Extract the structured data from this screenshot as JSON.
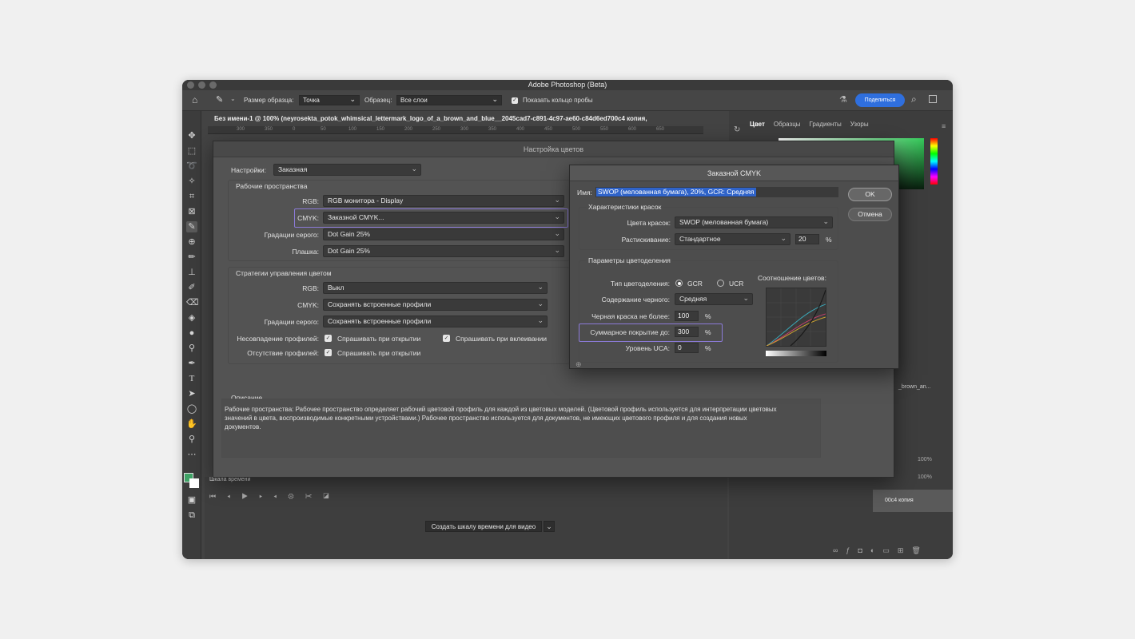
{
  "app": {
    "title": "Adobe Photoshop (Beta)",
    "share_label": "Поделиться"
  },
  "options_bar": {
    "sample_size_label": "Размер образца:",
    "sample_size_value": "Точка",
    "sample_label": "Образец:",
    "sample_value": "Все слои",
    "show_ring_label": "Показать кольцо пробы"
  },
  "document": {
    "tab_title": "Без имени-1 @ 100% (neyrosekta_potok_whimsical_lettermark_logo_of_a_brown_and_blue__2045cad7-c891-4c97-ae60-c84d6ed700c4 копия,",
    "ruler_ticks": [
      "300",
      "350",
      "0",
      "50",
      "100",
      "150",
      "200",
      "250",
      "300",
      "350",
      "400",
      "450",
      "500",
      "550",
      "600",
      "650"
    ]
  },
  "right_panel": {
    "tabs": [
      "Цвет",
      "Образцы",
      "Градиенты",
      "Узоры"
    ],
    "layer_name_fragment": "_brown_an...",
    "layer_copy_fragment": "00c4 копия",
    "opacity_value": "100%",
    "fill_value": "100%"
  },
  "timeline": {
    "label": "Шкала времени",
    "create_button": "Создать шкалу времени для видео"
  },
  "color_settings": {
    "title": "Настройка цветов",
    "settings_label": "Настройки:",
    "settings_value": "Заказная",
    "working_spaces": {
      "heading": "Рабочие пространства",
      "rgb_label": "RGB:",
      "rgb_value": "RGB монитора - Display",
      "cmyk_label": "CMYK:",
      "cmyk_value": "Заказной CMYK...",
      "gray_label": "Градации серого:",
      "gray_value": "Dot Gain 25%",
      "spot_label": "Плашка:",
      "spot_value": "Dot Gain 25%"
    },
    "policies": {
      "heading": "Стратегии управления цветом",
      "rgb_label": "RGB:",
      "rgb_value": "Выкл",
      "cmyk_label": "CMYK:",
      "cmyk_value": "Сохранять встроенные профили",
      "gray_label": "Градации серого:",
      "gray_value": "Сохранять встроенные профили",
      "mismatch_label": "Несовпадение профилей:",
      "ask_open": "Спрашивать при открытии",
      "ask_paste": "Спрашивать при вклеивании",
      "missing_label": "Отсутствие профилей:",
      "missing_ask_open": "Спрашивать при открытии"
    },
    "description": {
      "heading": "Описание",
      "text": "Рабочие пространства:  Рабочее пространство определяет рабочий цветовой профиль для каждой из цветовых моделей.  (Цветовой профиль используется для интерпретации цветовых значений в цвета, воспроизводимые конкретными устройствами.)  Рабочее пространство используется для документов, не имеющих цветового профиля и для создания новых документов."
    }
  },
  "custom_cmyk": {
    "title": "Заказной CMYK",
    "name_label": "Имя:",
    "name_value": "SWOP (мелованная бумага), 20%, GCR: Средняя",
    "ok_label": "OK",
    "cancel_label": "Отмена",
    "ink_options": {
      "heading": "Характеристики красок",
      "ink_colors_label": "Цвета красок:",
      "ink_colors_value": "SWOP (мелованная бумага)",
      "dot_gain_label": "Растискивание:",
      "dot_gain_mode": "Стандартное",
      "dot_gain_value": "20",
      "percent": "%"
    },
    "separation": {
      "heading": "Параметры цветоделения",
      "type_label": "Тип цветоделения:",
      "gcr_label": "GCR",
      "ucr_label": "UCR",
      "selected": "GCR",
      "black_gen_label": "Содержание черного:",
      "black_gen_value": "Средняя",
      "black_limit_label": "Черная краска не более:",
      "black_limit_value": "100",
      "total_ink_label": "Суммарное покрытие до:",
      "total_ink_value": "300",
      "uca_label": "Уровень UCA:",
      "uca_value": "0",
      "percent": "%",
      "gray_ramp_label": "Соотношение цветов:"
    }
  },
  "colors": {
    "accent_blue": "#2f6fde",
    "highlight_purple": "#8c7bd9",
    "foreground_swatch": "#3fa366"
  }
}
